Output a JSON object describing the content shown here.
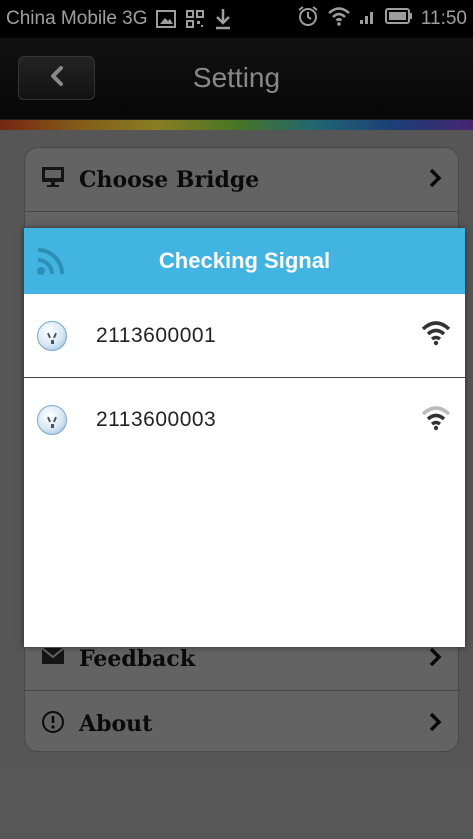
{
  "status_bar": {
    "carrier": "China Mobile 3G",
    "time": "11:50",
    "icons": [
      "image-notification-icon",
      "qr-code-icon",
      "download-icon",
      "alarm-icon",
      "wifi-icon",
      "signal-bars-icon",
      "battery-icon"
    ]
  },
  "header": {
    "title": "Setting",
    "back_icon": "chevron-left-icon"
  },
  "settings": {
    "items": [
      {
        "label": "Choose Bridge",
        "icon": "monitor-icon"
      },
      {
        "label": "Feedback",
        "icon": "envelope-icon"
      },
      {
        "label": "About",
        "icon": "info-circle-icon"
      }
    ]
  },
  "dialog": {
    "title": "Checking Signal",
    "title_icon": "rss-signal-icon",
    "devices": [
      {
        "name": "2113600001",
        "signal": "strong"
      },
      {
        "name": "2113600003",
        "signal": "medium"
      }
    ]
  },
  "colors": {
    "dialog_header": "#42b4e1",
    "status_bar": "#000000",
    "setting_bg": "#8c8c8c"
  }
}
